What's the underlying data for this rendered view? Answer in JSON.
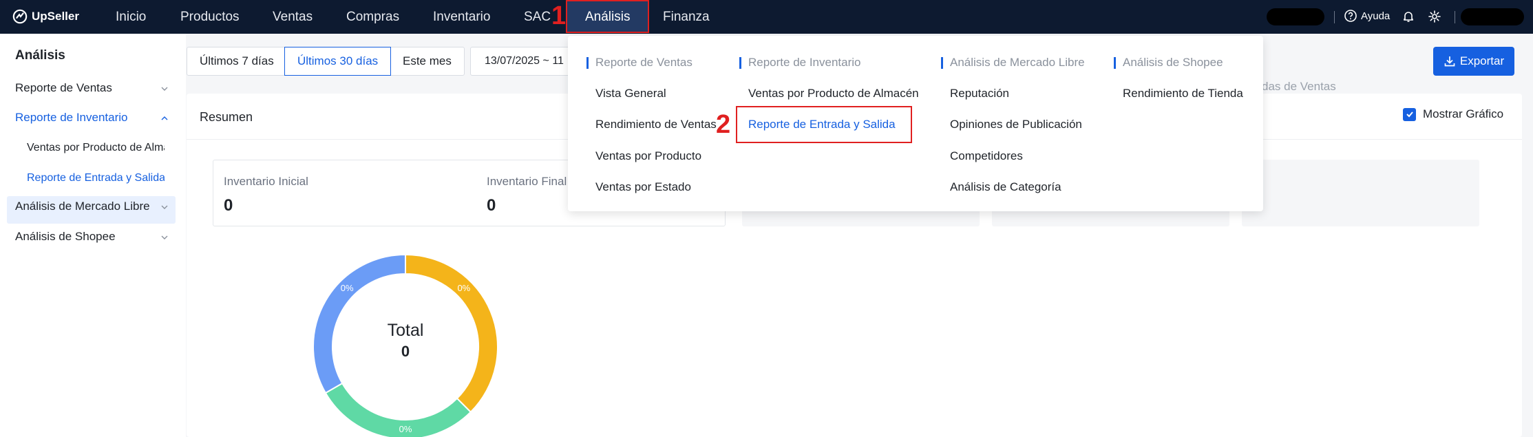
{
  "app": {
    "logo_text": "UpSeller"
  },
  "topnav": {
    "items": [
      {
        "label": "Inicio"
      },
      {
        "label": "Productos"
      },
      {
        "label": "Ventas"
      },
      {
        "label": "Compras"
      },
      {
        "label": "Inventario"
      },
      {
        "label": "SAC"
      },
      {
        "label": "Análisis"
      },
      {
        "label": "Finanza"
      }
    ],
    "help_label": "Ayuda"
  },
  "annotations": {
    "step1": "1",
    "step2": "2"
  },
  "sidebar": {
    "title": "Análisis",
    "items": [
      {
        "label": "Reporte de Ventas"
      },
      {
        "label": "Reporte de Inventario"
      },
      {
        "label": "Análisis de Mercado Libre"
      },
      {
        "label": "Análisis de Shopee"
      }
    ],
    "sub_items": [
      {
        "label": "Ventas por Producto de Almacén"
      },
      {
        "label": "Reporte de Entrada y Salida"
      }
    ]
  },
  "filters": {
    "ranges": [
      "Últimos 7 días",
      "Últimos 30 días",
      "Este mes"
    ],
    "date_text": "13/07/2025 ~ 11"
  },
  "export_label": "Exportar",
  "summary": {
    "title": "Resumen",
    "show_graph_label": "Mostrar Gráfico",
    "stats": [
      {
        "label": "Inventario Inicial",
        "value": "0"
      },
      {
        "label": "Inventario Final",
        "value": "0"
      }
    ],
    "partial_label": "alidas de Ventas"
  },
  "donut": {
    "total_label": "Total",
    "total_value": "0",
    "slices": [
      {
        "label": "0%",
        "color": "#f4b41a"
      },
      {
        "label": "0%",
        "color": "#5fd9a5"
      },
      {
        "label": "0%",
        "color": "#6b9cf6"
      }
    ]
  },
  "dropdown": {
    "columns": [
      {
        "header": "Reporte de Ventas",
        "links": [
          "Vista General",
          "Rendimiento de Ventas",
          "Ventas por Producto",
          "Ventas por Estado"
        ]
      },
      {
        "header": "Reporte de Inventario",
        "links": [
          "Ventas por Producto de Almacén",
          "Reporte de Entrada y Salida"
        ]
      },
      {
        "header": "Análisis de Mercado Libre",
        "links": [
          "Reputación",
          "Opiniones de Publicación",
          "Competidores",
          "Análisis de Categoría"
        ]
      },
      {
        "header": "Análisis de Shopee",
        "links": [
          "Rendimiento de Tienda"
        ]
      }
    ]
  },
  "colors": {
    "accent": "#1660e0",
    "nav_bg": "#0d1a30",
    "annotation_red": "#e02020"
  }
}
